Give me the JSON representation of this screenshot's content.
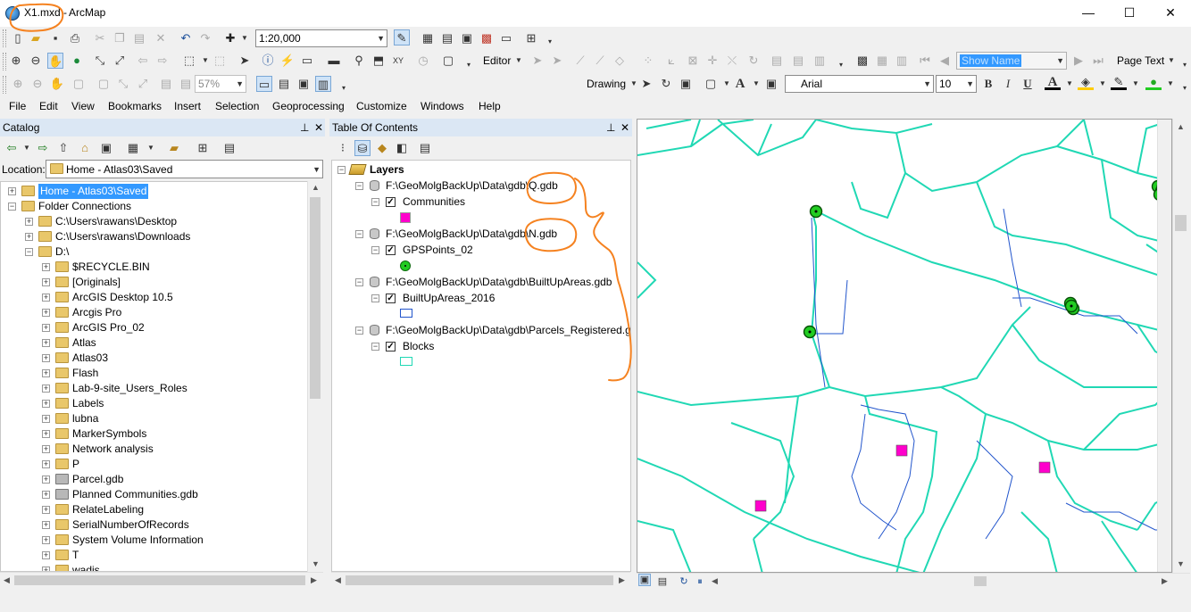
{
  "window": {
    "doc_title": "X1.mxd",
    "sep": "-",
    "app_name": "ArcMap",
    "minimize": "—",
    "maximize": "☐",
    "close": "✕"
  },
  "toolbar": {
    "scale": "1:20,000",
    "editor_label": "Editor",
    "show_name": "Show Name",
    "page_text": "Page Text",
    "zoom_pct": "57%",
    "drawing_label": "Drawing",
    "font_name": "Arial",
    "font_size": "10",
    "bold": "B",
    "italic": "I",
    "underline": "U",
    "text_a": "A"
  },
  "menu": [
    "File",
    "Edit",
    "View",
    "Bookmarks",
    "Insert",
    "Selection",
    "Geoprocessing",
    "Customize",
    "Windows",
    "Help"
  ],
  "catalog": {
    "title": "Catalog",
    "pin": "⊥",
    "close": "✕",
    "location_label": "Location:",
    "location_value": "Home - Atlas03\\Saved",
    "items": [
      {
        "label": "Home - Atlas03\\Saved",
        "level": 0,
        "selected": true
      },
      {
        "label": "Folder Connections",
        "level": 0
      },
      {
        "label": "C:\\Users\\rawans\\Desktop",
        "level": 1
      },
      {
        "label": "C:\\Users\\rawans\\Downloads",
        "level": 1
      },
      {
        "label": "D:\\",
        "level": 1
      },
      {
        "label": "$RECYCLE.BIN",
        "level": 2
      },
      {
        "label": "[Originals]",
        "level": 2
      },
      {
        "label": "ArcGIS Desktop 10.5",
        "level": 2
      },
      {
        "label": "Arcgis Pro",
        "level": 2
      },
      {
        "label": "ArcGIS Pro_02",
        "level": 2
      },
      {
        "label": "Atlas",
        "level": 2
      },
      {
        "label": "Atlas03",
        "level": 2
      },
      {
        "label": "Flash",
        "level": 2
      },
      {
        "label": "Lab-9-site_Users_Roles",
        "level": 2
      },
      {
        "label": "Labels",
        "level": 2
      },
      {
        "label": "lubna",
        "level": 2
      },
      {
        "label": "MarkerSymbols",
        "level": 2
      },
      {
        "label": "Network analysis",
        "level": 2
      },
      {
        "label": "P",
        "level": 2
      },
      {
        "label": "Parcel.gdb",
        "level": 2
      },
      {
        "label": "Planned Communities.gdb",
        "level": 2
      },
      {
        "label": "RelateLabeling",
        "level": 2
      },
      {
        "label": "SerialNumberOfRecords",
        "level": 2
      },
      {
        "label": "System Volume Information",
        "level": 2
      },
      {
        "label": "T",
        "level": 2
      },
      {
        "label": "wadis",
        "level": 2
      }
    ]
  },
  "toc": {
    "title": "Table Of Contents",
    "pin": "⊥",
    "close": "✕",
    "root": "Layers",
    "groups": [
      {
        "source": "F:\\GeoMolgBackUp\\Data\\gdb\\Q.gdb",
        "layer": "Communities",
        "symbol": "square-fill",
        "color": "#ff00cc"
      },
      {
        "source": "F:\\GeoMolgBackUp\\Data\\gdb\\N.gdb",
        "layer": "GPSPoints_02",
        "symbol": "circle-dot",
        "color": "#22cc22"
      },
      {
        "source": "F:\\GeoMolgBackUp\\Data\\gdb\\BuiltUpAreas.gdb",
        "layer": "BuiltUpAreas_2016",
        "symbol": "square-outline",
        "color": "#2255cc"
      },
      {
        "source": "F:\\GeoMolgBackUp\\Data\\gdb\\Parcels_Registered.gdb",
        "layer": "Blocks",
        "symbol": "square-outline",
        "color": "#20d8b4"
      }
    ]
  },
  "colors": {
    "blocks": "#20d8b4",
    "builtup": "#2255cc",
    "communities": "#ff00cc",
    "gps": "#22cc22",
    "annotation": "#f58220",
    "selection": "#3399ff"
  }
}
